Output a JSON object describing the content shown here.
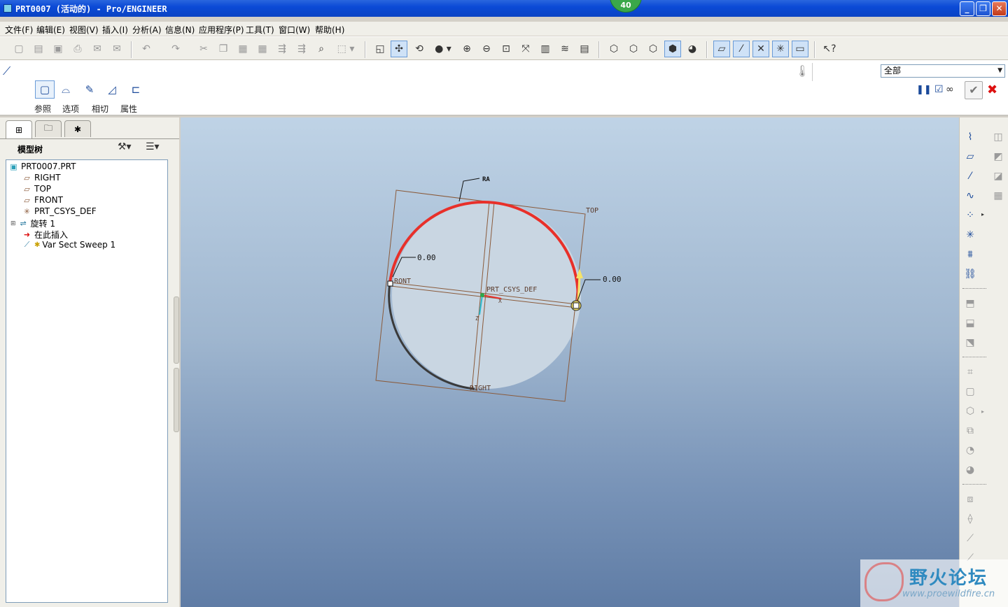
{
  "window": {
    "title": "PRT0007 (活动的) - Pro/ENGINEER",
    "badge": "40",
    "minimize_label": "_",
    "restore_label": "❐",
    "close_label": "✕"
  },
  "menu": [
    "文件(F)",
    "编辑(E)",
    "视图(V)",
    "插入(I)",
    "分析(A)",
    "信息(N)",
    "应用程序(P)",
    "工具(T)",
    "窗口(W)",
    "帮助(H)"
  ],
  "toolbar": {
    "icons": [
      "new-file-icon",
      "open-file-icon",
      "save-icon",
      "print-icon",
      "send-mail-icon",
      "send-mail-attach-icon",
      "undo-icon",
      "redo-icon",
      "cut-icon",
      "copy-icon",
      "paste-icon",
      "paste-special-icon",
      "regenerate-icon",
      "regenerate-manager-icon",
      "find-icon",
      "select-box-icon",
      "redraw-icon",
      "spin-center-icon",
      "orient-mode-icon",
      "shade-sphere-icon",
      "zoom-in-icon",
      "zoom-out-icon",
      "refit-icon",
      "reorient-icon",
      "saved-views-icon",
      "layers-icon",
      "view-manager-icon",
      "wireframe-icon",
      "hidden-line-icon",
      "no-hidden-icon",
      "shading-icon",
      "enhanced-realism-icon",
      "datum-planes-toggle-icon",
      "datum-axes-toggle-icon",
      "datum-points-toggle-icon",
      "csys-toggle-icon",
      "annotations-toggle-icon",
      "context-help-icon"
    ]
  },
  "dashboard": {
    "tabs": [
      {
        "label": "参照",
        "icon": "references-icon"
      },
      {
        "label": "选项",
        "icon": "options-icon"
      },
      {
        "label": "相切",
        "icon": "tangency-icon"
      },
      {
        "label": "属性",
        "icon": "properties-icon"
      }
    ],
    "filter": "全部",
    "pause_label": "❚❚",
    "preview_label": "☑",
    "verify_label": "∞",
    "ok_label": "✔",
    "cancel_label": "✖"
  },
  "model_tree": {
    "heading": "模型树",
    "items": [
      {
        "label": "PRT0007.PRT",
        "icon": "part-icon"
      },
      {
        "label": "RIGHT",
        "icon": "datum-plane-icon"
      },
      {
        "label": "TOP",
        "icon": "datum-plane-icon"
      },
      {
        "label": "FRONT",
        "icon": "datum-plane-icon"
      },
      {
        "label": "PRT_CSYS_DEF",
        "icon": "csys-icon"
      },
      {
        "label": "旋转 1",
        "icon": "revolve-icon"
      },
      {
        "label": "在此插入",
        "icon": "insert-here-arrow-icon"
      },
      {
        "label": "Var Sect Sweep 1",
        "icon": "var-sect-sweep-icon"
      }
    ]
  },
  "graphics": {
    "labels": {
      "top_plane": "TOP",
      "front_plane": "RONT",
      "right_plane": "RIGHT",
      "csys": "PRT_CSYS_DEF",
      "start_value": "0.00",
      "end_value": "0.00",
      "trajectory_label": "RA",
      "axis_x": "X",
      "axis_z": "Z"
    },
    "colors": {
      "trajectory_selected": "#e8302a",
      "trajectory": "#3a3a3a",
      "datum_plane": "#8a5a3a",
      "part_surface": "#c9d6e2",
      "background_top": "#bfd3e6",
      "background_bottom": "#5f7ca5"
    }
  },
  "watermark": {
    "text": "野火论坛",
    "url": "www.proewildfire.cn"
  }
}
